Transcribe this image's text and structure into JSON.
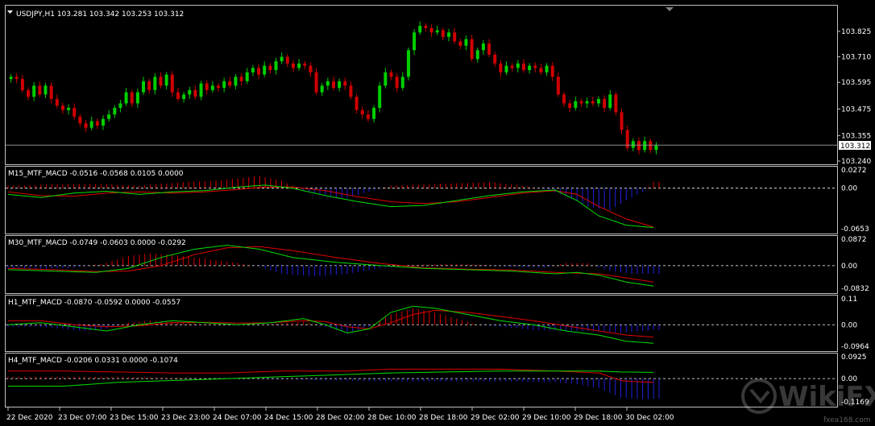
{
  "colors": {
    "background": "#000000",
    "frame": "#c0c0c0",
    "bull": "#00d000",
    "bear": "#d00000",
    "macd_line": "#00e000",
    "signal_line": "#e00000",
    "hist_pos": "#e00000",
    "hist_neg": "#2020e0",
    "zero_line": "#ffffff",
    "text": "#ffffff",
    "price_box_bg": "#ffffff",
    "price_box_text": "#000000"
  },
  "watermark": {
    "brand": "WikiFX",
    "site": "fxea168.com"
  },
  "chart_data": [
    {
      "type": "candlestick",
      "name": "price",
      "title": "USDJPY,H1  103.281 103.342 103.253 103.312",
      "symbol": "USDJPY,H1",
      "ohlc_header": [
        "103.281",
        "103.342",
        "103.253",
        "103.312"
      ],
      "current_price": "103.312",
      "ylim": [
        103.24,
        103.93
      ],
      "yticks": [
        "103.825",
        "103.710",
        "103.595",
        "103.475",
        "103.355",
        "103.240"
      ],
      "ytick_values": [
        103.825,
        103.71,
        103.595,
        103.475,
        103.355,
        103.24
      ],
      "close": [
        103.62,
        103.61,
        103.56,
        103.53,
        103.58,
        103.54,
        103.58,
        103.52,
        103.49,
        103.47,
        103.48,
        103.44,
        103.41,
        103.39,
        103.42,
        103.4,
        103.43,
        103.45,
        103.48,
        103.5,
        103.55,
        103.5,
        103.55,
        103.6,
        103.56,
        103.62,
        103.58,
        103.63,
        103.55,
        103.52,
        103.54,
        103.56,
        103.53,
        103.59,
        103.56,
        103.58,
        103.57,
        103.6,
        103.58,
        103.62,
        103.6,
        103.64,
        103.66,
        103.63,
        103.67,
        103.65,
        103.69,
        103.71,
        103.68,
        103.66,
        103.68,
        103.67,
        103.64,
        103.55,
        103.58,
        103.6,
        103.57,
        103.6,
        103.58,
        103.53,
        103.47,
        103.45,
        103.43,
        103.48,
        103.58,
        103.64,
        103.62,
        103.57,
        103.62,
        103.74,
        103.82,
        103.85,
        103.84,
        103.82,
        103.83,
        103.8,
        103.82,
        103.78,
        103.76,
        103.79,
        103.7,
        103.74,
        103.77,
        103.72,
        103.68,
        103.64,
        103.67,
        103.66,
        103.68,
        103.65,
        103.67,
        103.66,
        103.64,
        103.67,
        103.62,
        103.54,
        103.5,
        103.48,
        103.51,
        103.5,
        103.51,
        103.5,
        103.52,
        103.48,
        103.54,
        103.46,
        103.38,
        103.3,
        103.33,
        103.29,
        103.33,
        103.29,
        103.31
      ],
      "x_labels": [
        "22 Dec 2020",
        "23 Dec 07:00",
        "23 Dec 15:00",
        "23 Dec 23:00",
        "24 Dec 07:00",
        "24 Dec 15:00",
        "28 Dec 02:00",
        "28 Dec 10:00",
        "28 Dec 18:00",
        "29 Dec 02:00",
        "29 Dec 10:00",
        "29 Dec 18:00",
        "30 Dec 02:00"
      ]
    },
    {
      "type": "macd",
      "name": "M15_MTF_MACD",
      "title": "M15_MTF_MACD -0.0516 -0.0568 0.0105 0.0000",
      "header_values": [
        "-0.0516",
        "-0.0568",
        "0.0105",
        "0.0000"
      ],
      "yticks": [
        "0.0272",
        "0.00",
        "-0.0653"
      ],
      "ylim": [
        -0.071,
        0.031
      ],
      "macd": [
        [
          0,
          -0.01
        ],
        [
          6,
          -0.015
        ],
        [
          12,
          -0.008
        ],
        [
          18,
          -0.005
        ],
        [
          24,
          -0.01
        ],
        [
          30,
          -0.006
        ],
        [
          36,
          -0.004
        ],
        [
          42,
          0.002
        ],
        [
          47,
          0.005
        ],
        [
          52,
          0.0
        ],
        [
          58,
          -0.012
        ],
        [
          64,
          -0.022
        ],
        [
          70,
          -0.03
        ],
        [
          76,
          -0.028
        ],
        [
          82,
          -0.02
        ],
        [
          88,
          -0.012
        ],
        [
          94,
          -0.006
        ],
        [
          100,
          -0.003
        ],
        [
          104,
          -0.02
        ],
        [
          108,
          -0.045
        ],
        [
          113,
          -0.06
        ],
        [
          118,
          -0.064
        ]
      ],
      "signal": [
        [
          0,
          -0.006
        ],
        [
          6,
          -0.012
        ],
        [
          12,
          -0.013
        ],
        [
          18,
          -0.008
        ],
        [
          24,
          -0.006
        ],
        [
          30,
          -0.008
        ],
        [
          36,
          -0.006
        ],
        [
          42,
          -0.002
        ],
        [
          47,
          0.002
        ],
        [
          52,
          0.002
        ],
        [
          58,
          -0.004
        ],
        [
          64,
          -0.014
        ],
        [
          70,
          -0.022
        ],
        [
          76,
          -0.025
        ],
        [
          82,
          -0.022
        ],
        [
          88,
          -0.015
        ],
        [
          94,
          -0.008
        ],
        [
          100,
          -0.004
        ],
        [
          104,
          -0.01
        ],
        [
          108,
          -0.03
        ],
        [
          113,
          -0.05
        ],
        [
          118,
          -0.063
        ]
      ],
      "histogram": [
        [
          0,
          0.004
        ],
        [
          8,
          0.006
        ],
        [
          16,
          0.007
        ],
        [
          24,
          0.004
        ],
        [
          32,
          0.01
        ],
        [
          38,
          0.012
        ],
        [
          42,
          0.016
        ],
        [
          46,
          0.02
        ],
        [
          50,
          0.012
        ],
        [
          54,
          -0.004
        ],
        [
          58,
          -0.012
        ],
        [
          62,
          -0.016
        ],
        [
          66,
          -0.006
        ],
        [
          70,
          0.004
        ],
        [
          76,
          0.006
        ],
        [
          82,
          0.008
        ],
        [
          88,
          0.01
        ],
        [
          94,
          0.004
        ],
        [
          98,
          -0.002
        ],
        [
          102,
          -0.012
        ],
        [
          106,
          -0.03
        ],
        [
          110,
          -0.036
        ],
        [
          113,
          -0.02
        ],
        [
          116,
          -0.006
        ],
        [
          118,
          0.01
        ]
      ]
    },
    {
      "type": "macd",
      "name": "M30_MTF_MACD",
      "title": "M30_MTF_MACD -0.0749 -0.0603 0.0000 -0.0292",
      "header_values": [
        "-0.0749",
        "-0.0603",
        "0.0000",
        "-0.0292"
      ],
      "yticks": [
        "0.0872",
        "0.00",
        "-0.0832"
      ],
      "ylim": [
        -0.095,
        0.1
      ],
      "macd": [
        [
          0,
          -0.015
        ],
        [
          8,
          -0.02
        ],
        [
          16,
          -0.025
        ],
        [
          22,
          -0.01
        ],
        [
          28,
          0.03
        ],
        [
          34,
          0.06
        ],
        [
          40,
          0.075
        ],
        [
          46,
          0.06
        ],
        [
          52,
          0.03
        ],
        [
          60,
          0.012
        ],
        [
          68,
          0.0
        ],
        [
          76,
          -0.01
        ],
        [
          84,
          -0.015
        ],
        [
          92,
          -0.02
        ],
        [
          100,
          -0.03
        ],
        [
          104,
          -0.025
        ],
        [
          108,
          -0.035
        ],
        [
          113,
          -0.06
        ],
        [
          118,
          -0.075
        ]
      ],
      "signal": [
        [
          0,
          -0.01
        ],
        [
          8,
          -0.015
        ],
        [
          16,
          -0.022
        ],
        [
          22,
          -0.02
        ],
        [
          28,
          0.0
        ],
        [
          34,
          0.04
        ],
        [
          40,
          0.065
        ],
        [
          46,
          0.07
        ],
        [
          52,
          0.055
        ],
        [
          60,
          0.03
        ],
        [
          68,
          0.008
        ],
        [
          76,
          -0.008
        ],
        [
          84,
          -0.013
        ],
        [
          92,
          -0.016
        ],
        [
          100,
          -0.025
        ],
        [
          104,
          -0.028
        ],
        [
          108,
          -0.03
        ],
        [
          113,
          -0.045
        ],
        [
          118,
          -0.06
        ]
      ],
      "histogram": [
        [
          0,
          -0.01
        ],
        [
          6,
          -0.012
        ],
        [
          12,
          -0.008
        ],
        [
          18,
          0.01
        ],
        [
          22,
          0.035
        ],
        [
          26,
          0.045
        ],
        [
          30,
          0.04
        ],
        [
          34,
          0.03
        ],
        [
          38,
          0.02
        ],
        [
          42,
          0.01
        ],
        [
          46,
          -0.005
        ],
        [
          50,
          -0.03
        ],
        [
          56,
          -0.04
        ],
        [
          62,
          -0.03
        ],
        [
          68,
          -0.01
        ],
        [
          74,
          0.003
        ],
        [
          80,
          0.006
        ],
        [
          86,
          0.004
        ],
        [
          92,
          -0.005
        ],
        [
          98,
          -0.008
        ],
        [
          102,
          0.01
        ],
        [
          106,
          0.008
        ],
        [
          110,
          -0.02
        ],
        [
          114,
          -0.03
        ],
        [
          118,
          -0.03
        ]
      ]
    },
    {
      "type": "macd",
      "name": "H1_MTF_MACD",
      "title": "H1_MTF_MACD -0.0870 -0.0592 0.0000 -0.0557",
      "header_values": [
        "-0.0870",
        "-0.0592",
        "0.0000",
        "-0.0557"
      ],
      "yticks": [
        "0.11",
        "0.00",
        "-0.0964"
      ],
      "ylim": [
        -0.12,
        0.13
      ],
      "macd": [
        [
          0,
          0.0
        ],
        [
          6,
          0.01
        ],
        [
          12,
          -0.01
        ],
        [
          18,
          -0.03
        ],
        [
          24,
          0.0
        ],
        [
          30,
          0.02
        ],
        [
          36,
          0.01
        ],
        [
          42,
          0.0
        ],
        [
          48,
          0.01
        ],
        [
          54,
          0.03
        ],
        [
          58,
          0.0
        ],
        [
          62,
          -0.04
        ],
        [
          66,
          -0.02
        ],
        [
          70,
          0.06
        ],
        [
          74,
          0.09
        ],
        [
          78,
          0.08
        ],
        [
          84,
          0.05
        ],
        [
          90,
          0.02
        ],
        [
          96,
          0.0
        ],
        [
          102,
          -0.03
        ],
        [
          108,
          -0.05
        ],
        [
          113,
          -0.08
        ],
        [
          118,
          -0.09
        ]
      ],
      "signal": [
        [
          0,
          0.02
        ],
        [
          6,
          0.02
        ],
        [
          12,
          0.0
        ],
        [
          18,
          -0.01
        ],
        [
          24,
          -0.005
        ],
        [
          30,
          0.01
        ],
        [
          36,
          0.012
        ],
        [
          42,
          0.008
        ],
        [
          48,
          0.01
        ],
        [
          54,
          0.02
        ],
        [
          58,
          0.015
        ],
        [
          62,
          -0.01
        ],
        [
          66,
          -0.02
        ],
        [
          70,
          0.01
        ],
        [
          74,
          0.05
        ],
        [
          78,
          0.07
        ],
        [
          84,
          0.06
        ],
        [
          90,
          0.04
        ],
        [
          96,
          0.02
        ],
        [
          102,
          -0.005
        ],
        [
          108,
          -0.03
        ],
        [
          113,
          -0.05
        ],
        [
          118,
          -0.06
        ]
      ],
      "histogram": [
        [
          0,
          -0.01
        ],
        [
          6,
          -0.01
        ],
        [
          10,
          -0.02
        ],
        [
          14,
          -0.03
        ],
        [
          18,
          -0.02
        ],
        [
          22,
          0.01
        ],
        [
          26,
          0.02
        ],
        [
          30,
          0.015
        ],
        [
          36,
          0.005
        ],
        [
          42,
          -0.003
        ],
        [
          48,
          0.004
        ],
        [
          54,
          0.015
        ],
        [
          58,
          -0.01
        ],
        [
          62,
          -0.04
        ],
        [
          66,
          -0.01
        ],
        [
          70,
          0.05
        ],
        [
          74,
          0.08
        ],
        [
          78,
          0.06
        ],
        [
          82,
          0.03
        ],
        [
          86,
          0.0
        ],
        [
          90,
          -0.01
        ],
        [
          96,
          -0.025
        ],
        [
          102,
          -0.03
        ],
        [
          108,
          -0.03
        ],
        [
          112,
          -0.04
        ],
        [
          116,
          -0.03
        ],
        [
          118,
          -0.025
        ]
      ]
    },
    {
      "type": "macd",
      "name": "H4_MTF_MACD",
      "title": "H4_MTF_MACD -0.0206 0.0331 0.0000 -0.1074",
      "header_values": [
        "-0.0206",
        "0.0331",
        "0.0000",
        "-0.1074"
      ],
      "yticks": [
        "0.0925",
        "0.00",
        "-0.1169"
      ],
      "ylim": [
        -0.14,
        0.12
      ],
      "macd": [
        [
          0,
          -0.04
        ],
        [
          10,
          -0.04
        ],
        [
          15,
          -0.03
        ],
        [
          20,
          -0.02
        ],
        [
          30,
          -0.01
        ],
        [
          40,
          0.0
        ],
        [
          50,
          0.01
        ],
        [
          60,
          0.02
        ],
        [
          70,
          0.03
        ],
        [
          80,
          0.035
        ],
        [
          90,
          0.04
        ],
        [
          100,
          0.04
        ],
        [
          108,
          0.04
        ],
        [
          112,
          0.035
        ],
        [
          118,
          0.033
        ]
      ],
      "signal": [
        [
          0,
          0.04
        ],
        [
          10,
          0.04
        ],
        [
          20,
          0.035
        ],
        [
          30,
          0.03
        ],
        [
          40,
          0.03
        ],
        [
          50,
          0.04
        ],
        [
          58,
          0.04
        ],
        [
          62,
          0.04
        ],
        [
          70,
          0.05
        ],
        [
          80,
          0.05
        ],
        [
          90,
          0.05
        ],
        [
          100,
          0.04
        ],
        [
          108,
          0.03
        ],
        [
          112,
          -0.01
        ],
        [
          114,
          -0.015
        ],
        [
          118,
          -0.02
        ]
      ],
      "histogram": [
        [
          0,
          0.01
        ],
        [
          20,
          0.01
        ],
        [
          40,
          0.0
        ],
        [
          60,
          -0.01
        ],
        [
          70,
          -0.015
        ],
        [
          80,
          -0.015
        ],
        [
          90,
          -0.015
        ],
        [
          100,
          -0.02
        ],
        [
          104,
          -0.03
        ],
        [
          108,
          -0.05
        ],
        [
          112,
          -0.1
        ],
        [
          116,
          -0.11
        ],
        [
          118,
          -0.107
        ]
      ]
    }
  ]
}
